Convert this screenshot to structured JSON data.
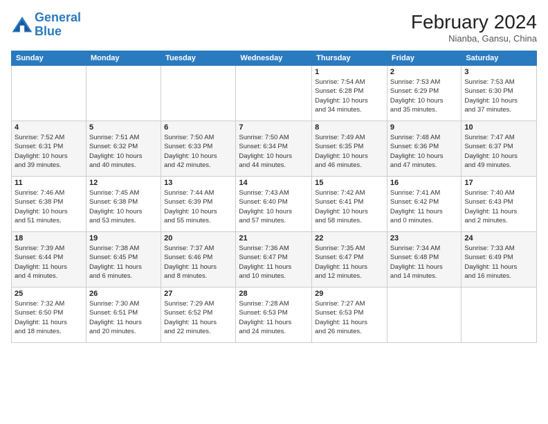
{
  "logo": {
    "line1": "General",
    "line2": "Blue"
  },
  "title": "February 2024",
  "location": "Nianba, Gansu, China",
  "weekdays": [
    "Sunday",
    "Monday",
    "Tuesday",
    "Wednesday",
    "Thursday",
    "Friday",
    "Saturday"
  ],
  "weeks": [
    [
      {
        "day": "",
        "info": ""
      },
      {
        "day": "",
        "info": ""
      },
      {
        "day": "",
        "info": ""
      },
      {
        "day": "",
        "info": ""
      },
      {
        "day": "1",
        "info": "Sunrise: 7:54 AM\nSunset: 6:28 PM\nDaylight: 10 hours\nand 34 minutes."
      },
      {
        "day": "2",
        "info": "Sunrise: 7:53 AM\nSunset: 6:29 PM\nDaylight: 10 hours\nand 35 minutes."
      },
      {
        "day": "3",
        "info": "Sunrise: 7:53 AM\nSunset: 6:30 PM\nDaylight: 10 hours\nand 37 minutes."
      }
    ],
    [
      {
        "day": "4",
        "info": "Sunrise: 7:52 AM\nSunset: 6:31 PM\nDaylight: 10 hours\nand 39 minutes."
      },
      {
        "day": "5",
        "info": "Sunrise: 7:51 AM\nSunset: 6:32 PM\nDaylight: 10 hours\nand 40 minutes."
      },
      {
        "day": "6",
        "info": "Sunrise: 7:50 AM\nSunset: 6:33 PM\nDaylight: 10 hours\nand 42 minutes."
      },
      {
        "day": "7",
        "info": "Sunrise: 7:50 AM\nSunset: 6:34 PM\nDaylight: 10 hours\nand 44 minutes."
      },
      {
        "day": "8",
        "info": "Sunrise: 7:49 AM\nSunset: 6:35 PM\nDaylight: 10 hours\nand 46 minutes."
      },
      {
        "day": "9",
        "info": "Sunrise: 7:48 AM\nSunset: 6:36 PM\nDaylight: 10 hours\nand 47 minutes."
      },
      {
        "day": "10",
        "info": "Sunrise: 7:47 AM\nSunset: 6:37 PM\nDaylight: 10 hours\nand 49 minutes."
      }
    ],
    [
      {
        "day": "11",
        "info": "Sunrise: 7:46 AM\nSunset: 6:38 PM\nDaylight: 10 hours\nand 51 minutes."
      },
      {
        "day": "12",
        "info": "Sunrise: 7:45 AM\nSunset: 6:38 PM\nDaylight: 10 hours\nand 53 minutes."
      },
      {
        "day": "13",
        "info": "Sunrise: 7:44 AM\nSunset: 6:39 PM\nDaylight: 10 hours\nand 55 minutes."
      },
      {
        "day": "14",
        "info": "Sunrise: 7:43 AM\nSunset: 6:40 PM\nDaylight: 10 hours\nand 57 minutes."
      },
      {
        "day": "15",
        "info": "Sunrise: 7:42 AM\nSunset: 6:41 PM\nDaylight: 10 hours\nand 58 minutes."
      },
      {
        "day": "16",
        "info": "Sunrise: 7:41 AM\nSunset: 6:42 PM\nDaylight: 11 hours\nand 0 minutes."
      },
      {
        "day": "17",
        "info": "Sunrise: 7:40 AM\nSunset: 6:43 PM\nDaylight: 11 hours\nand 2 minutes."
      }
    ],
    [
      {
        "day": "18",
        "info": "Sunrise: 7:39 AM\nSunset: 6:44 PM\nDaylight: 11 hours\nand 4 minutes."
      },
      {
        "day": "19",
        "info": "Sunrise: 7:38 AM\nSunset: 6:45 PM\nDaylight: 11 hours\nand 6 minutes."
      },
      {
        "day": "20",
        "info": "Sunrise: 7:37 AM\nSunset: 6:46 PM\nDaylight: 11 hours\nand 8 minutes."
      },
      {
        "day": "21",
        "info": "Sunrise: 7:36 AM\nSunset: 6:47 PM\nDaylight: 11 hours\nand 10 minutes."
      },
      {
        "day": "22",
        "info": "Sunrise: 7:35 AM\nSunset: 6:47 PM\nDaylight: 11 hours\nand 12 minutes."
      },
      {
        "day": "23",
        "info": "Sunrise: 7:34 AM\nSunset: 6:48 PM\nDaylight: 11 hours\nand 14 minutes."
      },
      {
        "day": "24",
        "info": "Sunrise: 7:33 AM\nSunset: 6:49 PM\nDaylight: 11 hours\nand 16 minutes."
      }
    ],
    [
      {
        "day": "25",
        "info": "Sunrise: 7:32 AM\nSunset: 6:50 PM\nDaylight: 11 hours\nand 18 minutes."
      },
      {
        "day": "26",
        "info": "Sunrise: 7:30 AM\nSunset: 6:51 PM\nDaylight: 11 hours\nand 20 minutes."
      },
      {
        "day": "27",
        "info": "Sunrise: 7:29 AM\nSunset: 6:52 PM\nDaylight: 11 hours\nand 22 minutes."
      },
      {
        "day": "28",
        "info": "Sunrise: 7:28 AM\nSunset: 6:53 PM\nDaylight: 11 hours\nand 24 minutes."
      },
      {
        "day": "29",
        "info": "Sunrise: 7:27 AM\nSunset: 6:53 PM\nDaylight: 11 hours\nand 26 minutes."
      },
      {
        "day": "",
        "info": ""
      },
      {
        "day": "",
        "info": ""
      }
    ]
  ]
}
